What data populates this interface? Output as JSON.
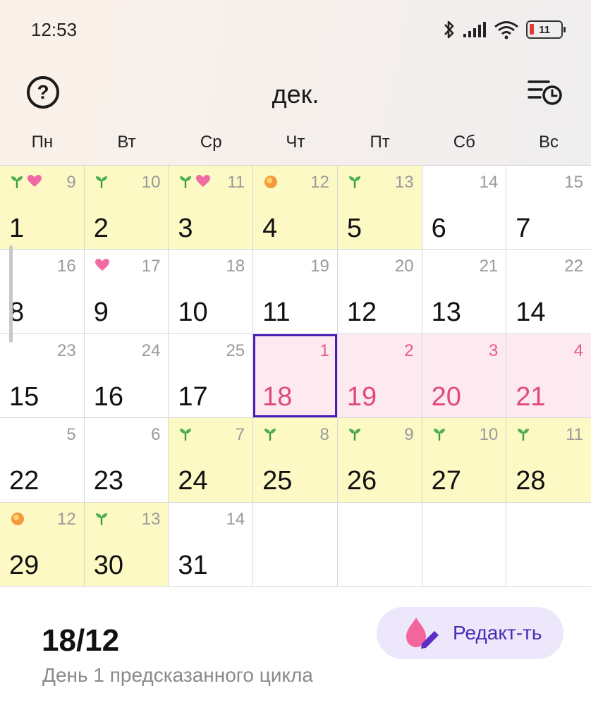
{
  "status_bar": {
    "time": "12:53",
    "battery": "11"
  },
  "header": {
    "month": "дек."
  },
  "weekdays": [
    "Пн",
    "Вт",
    "Ср",
    "Чт",
    "Пт",
    "Сб",
    "Вс"
  ],
  "colors": {
    "fertile": "#fcf9c5",
    "period": "#fdeaf0",
    "period_text": "#e0497f",
    "today_border": "#4a1fb8",
    "accent": "#4a2ab5"
  },
  "calendar": {
    "days": [
      {
        "date": "1",
        "cycle_day": "9",
        "state": "fertile",
        "markers": [
          "sprout-icon",
          "heart-icon"
        ]
      },
      {
        "date": "2",
        "cycle_day": "10",
        "state": "fertile",
        "markers": [
          "sprout-icon"
        ]
      },
      {
        "date": "3",
        "cycle_day": "11",
        "state": "fertile",
        "markers": [
          "sprout-icon",
          "heart-icon"
        ]
      },
      {
        "date": "4",
        "cycle_day": "12",
        "state": "fertile",
        "markers": [
          "ovulation-icon"
        ]
      },
      {
        "date": "5",
        "cycle_day": "13",
        "state": "fertile",
        "markers": [
          "sprout-icon"
        ]
      },
      {
        "date": "6",
        "cycle_day": "14",
        "state": "normal",
        "markers": []
      },
      {
        "date": "7",
        "cycle_day": "15",
        "state": "normal",
        "markers": []
      },
      {
        "date": "8",
        "cycle_day": "16",
        "state": "normal",
        "markers": []
      },
      {
        "date": "9",
        "cycle_day": "17",
        "state": "normal",
        "markers": [
          "heart-icon"
        ]
      },
      {
        "date": "10",
        "cycle_day": "18",
        "state": "normal",
        "markers": []
      },
      {
        "date": "11",
        "cycle_day": "19",
        "state": "normal",
        "markers": []
      },
      {
        "date": "12",
        "cycle_day": "20",
        "state": "normal",
        "markers": []
      },
      {
        "date": "13",
        "cycle_day": "21",
        "state": "normal",
        "markers": []
      },
      {
        "date": "14",
        "cycle_day": "22",
        "state": "normal",
        "markers": []
      },
      {
        "date": "15",
        "cycle_day": "23",
        "state": "normal",
        "markers": []
      },
      {
        "date": "16",
        "cycle_day": "24",
        "state": "normal",
        "markers": []
      },
      {
        "date": "17",
        "cycle_day": "25",
        "state": "normal",
        "markers": []
      },
      {
        "date": "18",
        "cycle_day": "1",
        "state": "period",
        "today": true,
        "markers": []
      },
      {
        "date": "19",
        "cycle_day": "2",
        "state": "period",
        "markers": []
      },
      {
        "date": "20",
        "cycle_day": "3",
        "state": "period",
        "markers": []
      },
      {
        "date": "21",
        "cycle_day": "4",
        "state": "period",
        "markers": []
      },
      {
        "date": "22",
        "cycle_day": "5",
        "state": "normal",
        "markers": []
      },
      {
        "date": "23",
        "cycle_day": "6",
        "state": "normal",
        "markers": []
      },
      {
        "date": "24",
        "cycle_day": "7",
        "state": "fertile",
        "markers": [
          "sprout-icon"
        ]
      },
      {
        "date": "25",
        "cycle_day": "8",
        "state": "fertile",
        "markers": [
          "sprout-icon"
        ]
      },
      {
        "date": "26",
        "cycle_day": "9",
        "state": "fertile",
        "markers": [
          "sprout-icon"
        ]
      },
      {
        "date": "27",
        "cycle_day": "10",
        "state": "fertile",
        "markers": [
          "sprout-icon"
        ]
      },
      {
        "date": "28",
        "cycle_day": "11",
        "state": "fertile",
        "markers": [
          "sprout-icon"
        ]
      },
      {
        "date": "29",
        "cycle_day": "12",
        "state": "fertile",
        "markers": [
          "ovulation-icon"
        ]
      },
      {
        "date": "30",
        "cycle_day": "13",
        "state": "fertile",
        "markers": [
          "sprout-icon"
        ]
      },
      {
        "date": "31",
        "cycle_day": "14",
        "state": "normal",
        "markers": []
      },
      {
        "date": "",
        "cycle_day": "",
        "state": "empty",
        "markers": []
      },
      {
        "date": "",
        "cycle_day": "",
        "state": "empty",
        "markers": []
      },
      {
        "date": "",
        "cycle_day": "",
        "state": "empty",
        "markers": []
      },
      {
        "date": "",
        "cycle_day": "",
        "state": "empty",
        "markers": []
      }
    ]
  },
  "selection": {
    "date": "18/12",
    "info": "День 1 предсказанного цикла",
    "edit_label": "Редакт-ть"
  }
}
